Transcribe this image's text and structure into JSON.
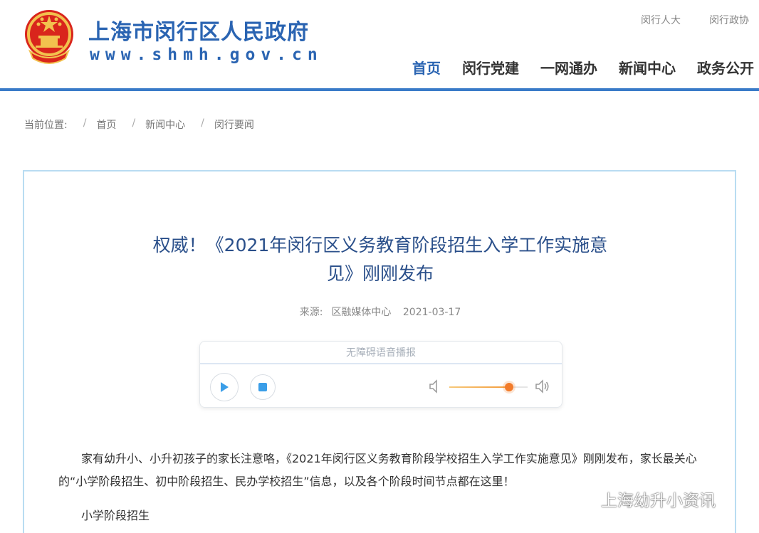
{
  "site": {
    "name": "上海市闵行区人民政府",
    "url": "www.shmh.gov.cn"
  },
  "toplinks": [
    "闵行人大",
    "闵行政协"
  ],
  "nav": [
    {
      "label": "首页",
      "active": true
    },
    {
      "label": "闵行党建",
      "active": false
    },
    {
      "label": "一网通办",
      "active": false
    },
    {
      "label": "新闻中心",
      "active": false
    },
    {
      "label": "政务公开",
      "active": false
    }
  ],
  "breadcrumb": {
    "label": "当前位置:",
    "items": [
      "首页",
      "新闻中心",
      "闵行要闻"
    ]
  },
  "article": {
    "title_line1": "权威！《2021年闵行区义务教育阶段招生入学工作实施意",
    "title_line2": "见》刚刚发布",
    "source_label": "来源:",
    "source": "区融媒体中心",
    "date": "2021-03-17",
    "paragraph1": "家有幼升小、小升初孩子的家长注意咯，《2021年闵行区义务教育阶段学校招生入学工作实施意见》刚刚发布，家长最关心的“小学阶段招生、初中阶段招生、民办学校招生”信息，以及各个阶段时间节点都在这里！",
    "section_heading": "小学阶段招生"
  },
  "player": {
    "label": "无障碍语音播报",
    "volume": 0.76,
    "play_icon": "play-icon",
    "stop_icon": "stop-icon",
    "accent_color": "#f27b2a"
  },
  "watermark": {
    "text": "上海幼升小资讯"
  },
  "colors": {
    "brand": "#2a64b2",
    "header_bar": "#3a7bc8",
    "box_border": "#b9dcf2"
  }
}
